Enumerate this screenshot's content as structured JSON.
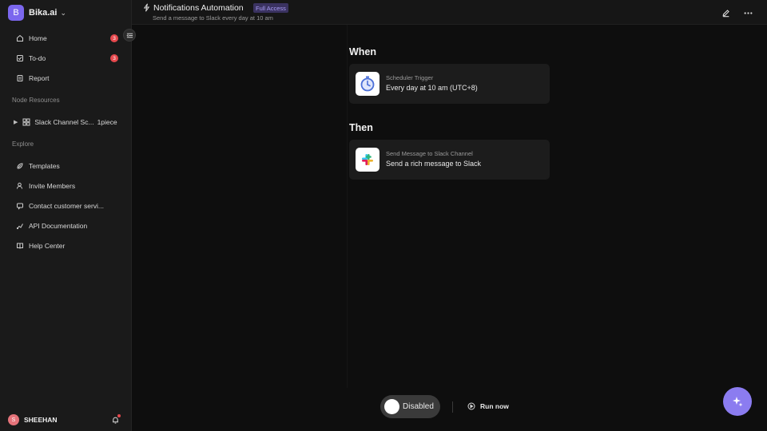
{
  "workspace": {
    "initial": "B",
    "name": "Bika.ai"
  },
  "sidebar": {
    "items": [
      {
        "label": "Home",
        "badge": "3"
      },
      {
        "label": "To-do",
        "badge": "3"
      },
      {
        "label": "Report"
      }
    ],
    "node_resources_title": "Node Resources",
    "node": {
      "label": "Slack Channel Sc...",
      "count": "1piece"
    },
    "explore_title": "Explore",
    "explore": [
      {
        "label": "Templates"
      },
      {
        "label": "Invite Members"
      },
      {
        "label": "Contact customer servi..."
      },
      {
        "label": "API Documentation"
      },
      {
        "label": "Help Center"
      }
    ]
  },
  "user": {
    "initial": "S",
    "name": "SHEEHAN"
  },
  "header": {
    "title": "Notifications Automation",
    "access": "Full Access",
    "subtitle": "Send a message to Slack every day at 10 am"
  },
  "automation": {
    "when_title": "When",
    "trigger": {
      "label": "Scheduler Trigger",
      "value": "Every day at 10 am (UTC+8)"
    },
    "then_title": "Then",
    "action": {
      "label": "Send Message to Slack Channel",
      "value": "Send a rich message to Slack"
    }
  },
  "controls": {
    "toggle_label": "Disabled",
    "run_label": "Run now"
  },
  "colors": {
    "accent": "#7b67ee",
    "badge": "#e5484d",
    "fab": "#8b7cf0"
  }
}
